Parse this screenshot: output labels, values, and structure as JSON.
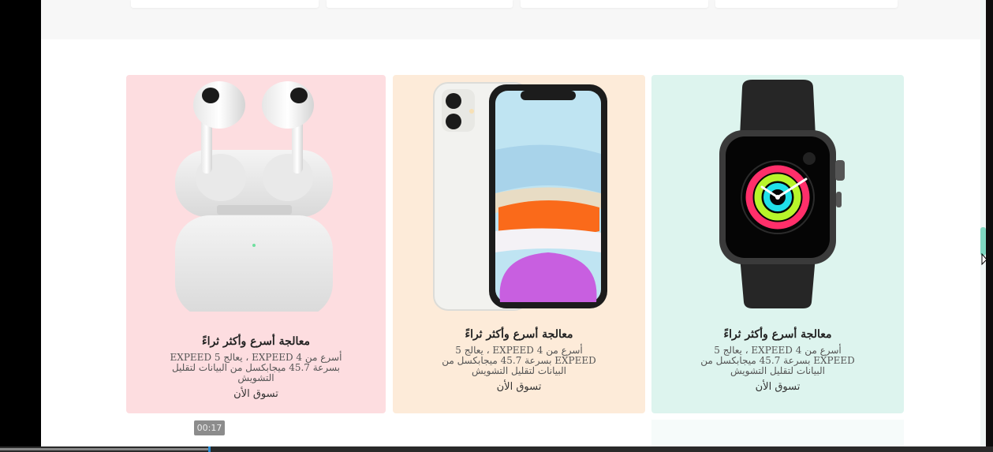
{
  "cards": [
    {
      "title": "معالجة أسرع وأكثر ثراءً",
      "desc": "أسرع من 4 EXPEED ، يعالج 5 EXPEED بسرعة 45.7 ميجابكسل من البيانات لتقليل التشويش",
      "cta": "تسوق الأن",
      "bg": "#fddde0",
      "image": "airpods-image"
    },
    {
      "title": "معالجة أسرع وأكثر ثراءً",
      "desc": "أسرع من 4 EXPEED ، يعالج 5 EXPEED بسرعة 45.7 ميجابكسل من البيانات لتقليل التشويش",
      "cta": "تسوق الأن",
      "bg": "#fdebd9",
      "image": "iphone-image"
    },
    {
      "title": "معالجة أسرع وأكثر ثراءً",
      "desc": "أسرع من 4 EXPEED ، يعالج 5 EXPEED بسرعة 45.7 ميجابكسل من البيانات لتقليل التشويش",
      "cta": "تسوق الأن",
      "bg": "#ddf4ee",
      "image": "watch-image"
    }
  ],
  "video": {
    "timestamp": "00:17",
    "progress": 0.21
  },
  "colors": {
    "scroll_thumb": "#7fd8c2",
    "progress_head": "#2b8fd8"
  }
}
